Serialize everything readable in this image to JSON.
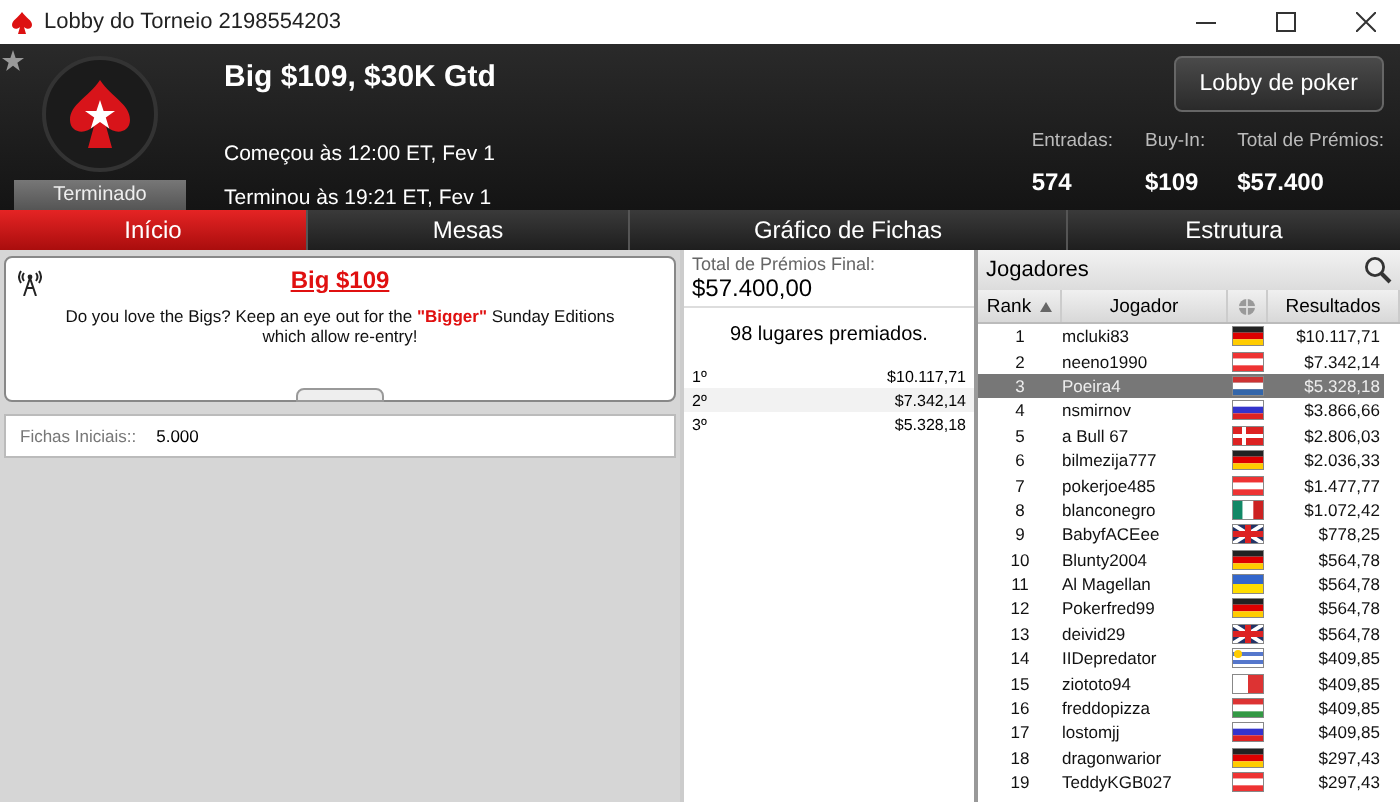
{
  "window": {
    "title": "Lobby do Torneio 2198554203"
  },
  "header": {
    "name": "Big $109, $30K Gtd",
    "status": "Terminado",
    "started": "Começou às 12:00 ET, Fev 1",
    "ended": "Terminou às 19:21 ET, Fev 1",
    "lobby_button": "Lobby de poker",
    "stats": [
      {
        "label": "Entradas:",
        "value": "574"
      },
      {
        "label": "Buy-In:",
        "value": "$109"
      },
      {
        "label": "Total de Prémios:",
        "value": "$57.400"
      }
    ]
  },
  "tabs": [
    {
      "label": "Início",
      "selected": true
    },
    {
      "label": "Mesas",
      "selected": false
    },
    {
      "label": "Gráfico de Fichas",
      "selected": false
    },
    {
      "label": "Estrutura",
      "selected": false
    }
  ],
  "announcement": {
    "title": "Big $109",
    "text": "Do you love the Bigs? Keep an eye out for the **\"Bigger\"** Sunday Editions which allow re-entry!"
  },
  "starting_chips": {
    "label": "Fichas Iniciais::",
    "value": "5.000"
  },
  "prizes": {
    "label": "Total de Prémios Final:",
    "total": "$57.400,00",
    "places": "98 lugares premiados.",
    "rows": [
      {
        "place": "1º",
        "amount": "$10.117,71"
      },
      {
        "place": "2º",
        "amount": "$7.342,14"
      },
      {
        "place": "3º",
        "amount": "$5.328,18"
      }
    ]
  },
  "players": {
    "title": "Jogadores",
    "columns": [
      "Rank",
      "Jogador",
      "Resultados"
    ],
    "rows": [
      {
        "rank": "1",
        "name": "mcluki83",
        "kind": "de",
        "result": "$10.117,71",
        "selected": false
      },
      {
        "rank": "2",
        "name": "neeno1990",
        "kind": "at",
        "result": "$7.342,14",
        "selected": false
      },
      {
        "rank": "3",
        "name": "Poeira4",
        "kind": "nl",
        "result": "$5.328,18",
        "selected": true
      },
      {
        "rank": "4",
        "name": "nsmirnov",
        "kind": "ru",
        "result": "$3.866,66",
        "selected": false
      },
      {
        "rank": "5",
        "name": "a Bull 67",
        "kind": "dk",
        "result": "$2.806,03",
        "selected": false
      },
      {
        "rank": "6",
        "name": "bilmezija777",
        "kind": "de",
        "result": "$2.036,33",
        "selected": false
      },
      {
        "rank": "7",
        "name": "pokerjoe485",
        "kind": "at",
        "result": "$1.477,77",
        "selected": false
      },
      {
        "rank": "8",
        "name": "blanconegro",
        "kind": "mx",
        "result": "$1.072,42",
        "selected": false
      },
      {
        "rank": "9",
        "name": "BabyfACEee",
        "kind": "gb",
        "result": "$778,25",
        "selected": false
      },
      {
        "rank": "10",
        "name": "Blunty2004",
        "kind": "de",
        "result": "$564,78",
        "selected": false
      },
      {
        "rank": "11",
        "name": "Al Magellan",
        "kind": "ua",
        "result": "$564,78",
        "selected": false
      },
      {
        "rank": "12",
        "name": "Pokerfred99",
        "kind": "de",
        "result": "$564,78",
        "selected": false
      },
      {
        "rank": "13",
        "name": "deivid29",
        "kind": "gb",
        "result": "$564,78",
        "selected": false
      },
      {
        "rank": "14",
        "name": "IIDepredator",
        "kind": "uy",
        "result": "$409,85",
        "selected": false
      },
      {
        "rank": "15",
        "name": "ziototo94",
        "kind": "mt",
        "result": "$409,85",
        "selected": false
      },
      {
        "rank": "16",
        "name": "freddopizza",
        "kind": "hu",
        "result": "$409,85",
        "selected": false
      },
      {
        "rank": "17",
        "name": "lostomjj",
        "kind": "ru",
        "result": "$409,85",
        "selected": false
      },
      {
        "rank": "18",
        "name": "dragonwarior",
        "kind": "de",
        "result": "$297,43",
        "selected": false
      },
      {
        "rank": "19",
        "name": "TeddyKGB027",
        "kind": "at",
        "result": "$297,43",
        "selected": false
      }
    ]
  }
}
